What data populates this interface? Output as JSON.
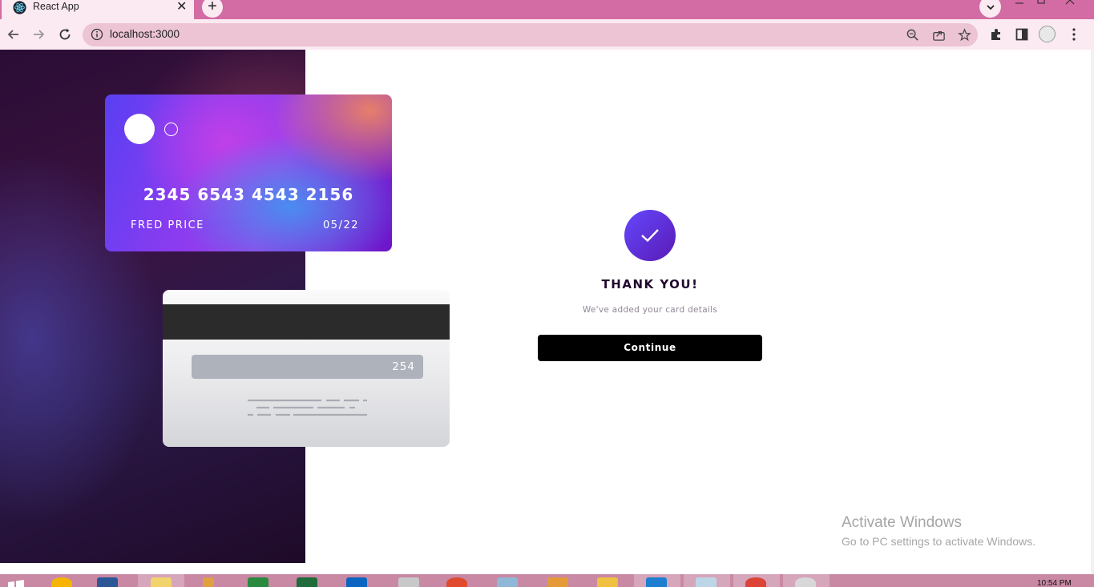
{
  "browser": {
    "tab_title": "React App",
    "tab_close": "✕",
    "new_tab": "+",
    "url": "localhost:3000"
  },
  "card_front": {
    "number": "2345 6543 4543 2156",
    "name": "FRED PRICE",
    "expiry": "05/22"
  },
  "card_back": {
    "cvc": "254"
  },
  "success": {
    "title": "THANK YOU!",
    "message": "We've added your card details",
    "button": "Continue"
  },
  "watermark": {
    "title": "Activate Windows",
    "subtitle": "Go to PC settings to activate Windows."
  },
  "taskbar": {
    "clock": "10:54 PM"
  },
  "colors": {
    "chrome": "#d36ba4",
    "accent": "#6448fe",
    "button": "#000000"
  }
}
